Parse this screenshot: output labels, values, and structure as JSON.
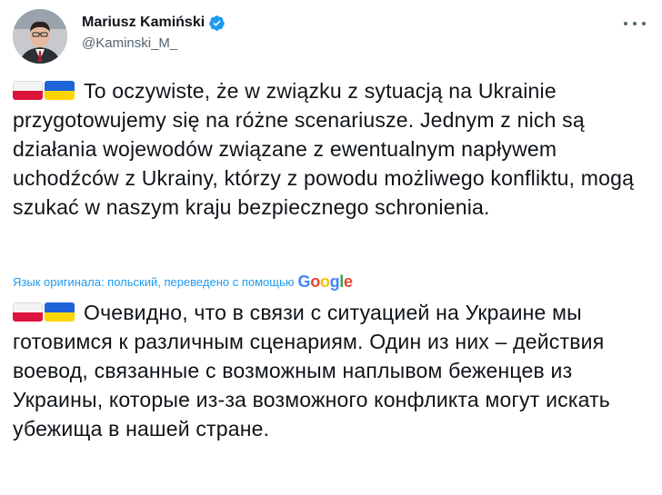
{
  "author": {
    "name": "Mariusz Kamiński",
    "handle": "@Kaminski_M_"
  },
  "icons": {
    "verified": "verified-badge-icon",
    "more": "more-options-icon",
    "flag_pl": "poland-flag-icon",
    "flag_ua": "ukraine-flag-icon"
  },
  "colors": {
    "text": "#0f1419",
    "secondary": "#536471",
    "link": "#1d9bf0",
    "verified": "#1d9bf0"
  },
  "tweet": {
    "original_text": "To oczywiste, że w związku z sytuacją na Ukrainie przygotowujemy się na różne scenariusze. Jednym z nich są działania wojewodów związane z ewentualnym napływem uchodźców z Ukrainy, którzy z powodu możliwego konfliktu, mogą szukać w naszym kraju bezpiecznego schronienia.",
    "translation_note": "Язык оригинала: польский, переведено с помощью",
    "translation_provider": "Google",
    "translated_text": "Очевидно, что в связи с ситуацией на Украине мы готовимся к различным сценариям. Один из них – действия воевод, связанные с возможным наплывом беженцев из Украины, которые из-за возможного конфликта могут искать убежища в нашей стране."
  }
}
